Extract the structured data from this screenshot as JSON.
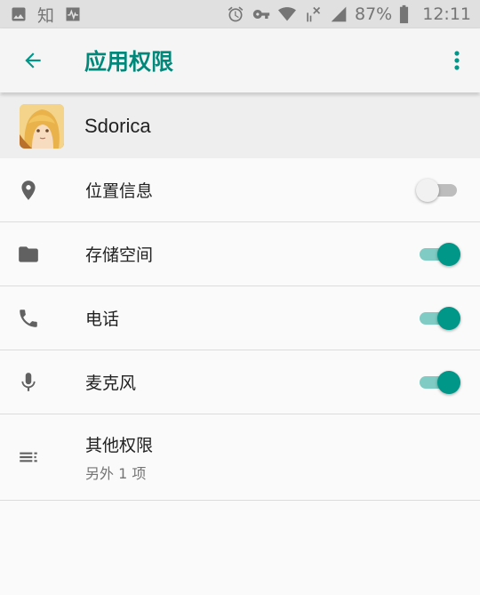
{
  "status_bar": {
    "left_icons": [
      "image-icon",
      "zhihu-icon",
      "pulse-icon"
    ],
    "zhihu_text": "知",
    "right_icons": [
      "alarm-icon",
      "vpn-key-icon",
      "wifi-icon",
      "no-signal-icon",
      "cell-signal-icon"
    ],
    "battery_percent": "87%",
    "time": "12:11"
  },
  "toolbar": {
    "back_icon": "arrow-back-icon",
    "title": "应用权限",
    "menu_icon": "more-vert-icon"
  },
  "app": {
    "name": "Sdorica"
  },
  "permissions": [
    {
      "icon": "location-icon",
      "label": "位置信息",
      "enabled": false
    },
    {
      "icon": "folder-icon",
      "label": "存储空间",
      "enabled": true
    },
    {
      "icon": "phone-icon",
      "label": "电话",
      "enabled": true
    },
    {
      "icon": "microphone-icon",
      "label": "麦克风",
      "enabled": true
    }
  ],
  "other_permissions": {
    "icon": "list-icon",
    "label": "其他权限",
    "subtitle": "另外 1 项"
  },
  "colors": {
    "accent": "#009688",
    "track_on": "#80cbc4",
    "toolbar_bg": "#f5f5f5",
    "header_bg": "#eeeeee",
    "status_bar_bg": "#e0e0e0"
  }
}
